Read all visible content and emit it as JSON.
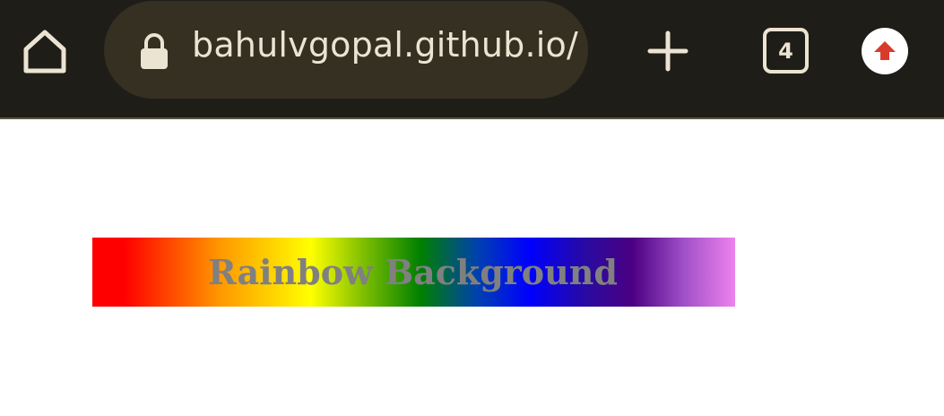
{
  "browser": {
    "url": "bahulvgopal.github.io/",
    "tab_count": "4",
    "icons": {
      "home": "home-icon",
      "lock": "lock-icon",
      "new_tab": "plus-icon",
      "tabs": "tab-switcher-icon",
      "update": "update-arrow-icon"
    },
    "colors": {
      "toolbar_bg": "#1f1d18",
      "url_pill_bg": "#353021",
      "icon_fg": "#ece4d2",
      "update_arrow": "#d93b2b"
    }
  },
  "page": {
    "title": "Rainbow Background",
    "title_color": "#808080",
    "gradient_colors": [
      "#ff0000",
      "#ff9900",
      "#ffff00",
      "#008000",
      "#0000ff",
      "#4b0082",
      "#ee82ee"
    ]
  }
}
